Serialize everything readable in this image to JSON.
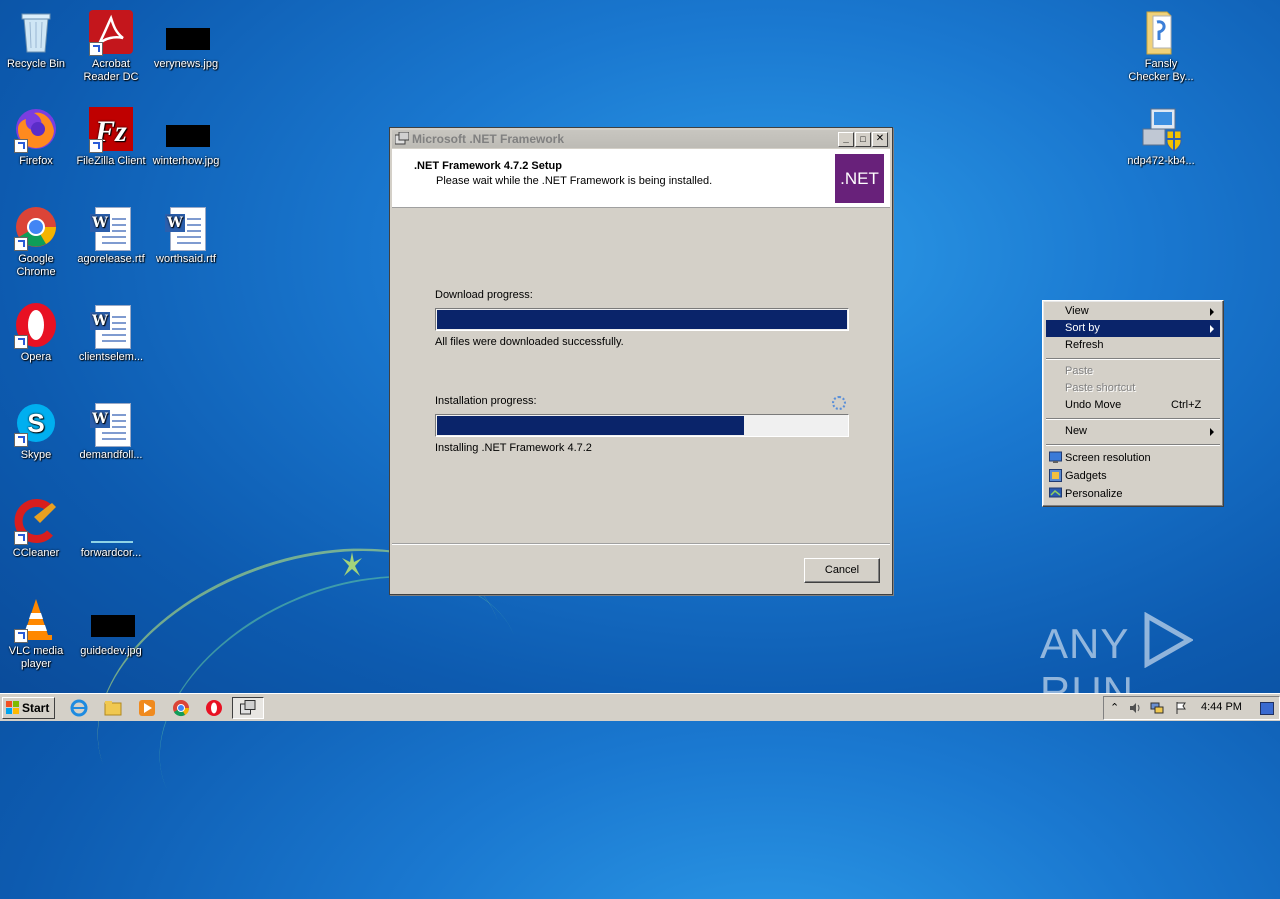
{
  "desktop": {
    "icons": [
      {
        "label": "Recycle Bin"
      },
      {
        "label": "Acrobat Reader DC"
      },
      {
        "label": "verynews.jpg"
      },
      {
        "label": "Firefox"
      },
      {
        "label": "FileZilla Client"
      },
      {
        "label": "winterhow.jpg"
      },
      {
        "label": "Google Chrome"
      },
      {
        "label": "agorelease.rtf"
      },
      {
        "label": "worthsaid.rtf"
      },
      {
        "label": "Opera"
      },
      {
        "label": "clientselem..."
      },
      {
        "label": "Skype"
      },
      {
        "label": "demandfoll..."
      },
      {
        "label": "CCleaner"
      },
      {
        "label": "forwardcor..."
      },
      {
        "label": "VLC media player"
      },
      {
        "label": "guidedev.jpg"
      },
      {
        "label": "Fansly Checker By..."
      },
      {
        "label": "ndp472-kb4..."
      }
    ]
  },
  "dialog": {
    "title": "Microsoft .NET Framework",
    "header_title": ".NET Framework 4.7.2 Setup",
    "header_subtitle": "Please wait while the .NET Framework is being installed.",
    "logo_text": ".NET",
    "download_label": "Download progress:",
    "download_progress": 1.0,
    "download_status": "All files were downloaded successfully.",
    "install_label": "Installation progress:",
    "install_progress": 0.75,
    "install_status": "Installing .NET Framework 4.7.2",
    "cancel_label": "Cancel",
    "minimize_glyph": "_",
    "maximize_glyph": "□",
    "close_glyph": "✕"
  },
  "context_menu": {
    "items": [
      {
        "label": "View",
        "submenu": true
      },
      {
        "label": "Sort by",
        "submenu": true,
        "selected": true
      },
      {
        "label": "Refresh"
      },
      {
        "label": "Paste",
        "disabled": true
      },
      {
        "label": "Paste shortcut",
        "disabled": true
      },
      {
        "label": "Undo Move",
        "shortcut": "Ctrl+Z"
      },
      {
        "label": "New",
        "submenu": true
      },
      {
        "label": "Screen resolution"
      },
      {
        "label": "Gadgets"
      },
      {
        "label": "Personalize"
      }
    ]
  },
  "taskbar": {
    "start_label": "Start",
    "clock": "4:44 PM"
  },
  "watermark": {
    "left": "ANY",
    "right": "RUN"
  },
  "colors": {
    "progress_fill": "#0a246a",
    "net_purple": "#68217a",
    "menu_highlight": "#0a246a"
  }
}
